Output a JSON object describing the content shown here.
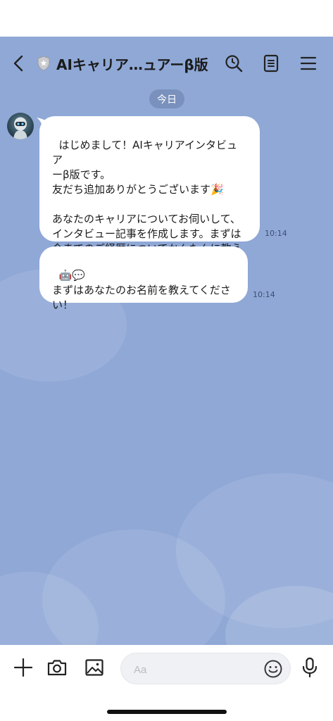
{
  "header": {
    "title": "AIキャリア…ュアーβ版"
  },
  "chat": {
    "date_divider": "今日",
    "messages": [
      {
        "text": "はじめまして！AIキャリアインタビュア\nーβ版です。\n友だち追加ありがとうございます🎉\n\nあなたのキャリアについてお伺いして、\nインタビュー記事を作成します。まずは\n今までのご経歴についてかんたんに教え\nてくださいね！",
        "time": "10:14"
      },
      {
        "text": "🤖💬\nまずはあなたのお名前を教えてくださ\nい！",
        "time": "10:14"
      }
    ]
  },
  "input": {
    "placeholder": "Aa"
  },
  "colors": {
    "chat_background": "#8fa8d6",
    "bubble": "#ffffff",
    "date_pill": "#7a91bd",
    "text": "#1b1b1b"
  },
  "icons": {
    "header": [
      "back-icon",
      "shield-icon",
      "search-icon",
      "notes-icon",
      "menu-icon"
    ],
    "input_bar": [
      "plus-icon",
      "camera-icon",
      "image-icon",
      "emoji-icon",
      "microphone-icon"
    ]
  }
}
